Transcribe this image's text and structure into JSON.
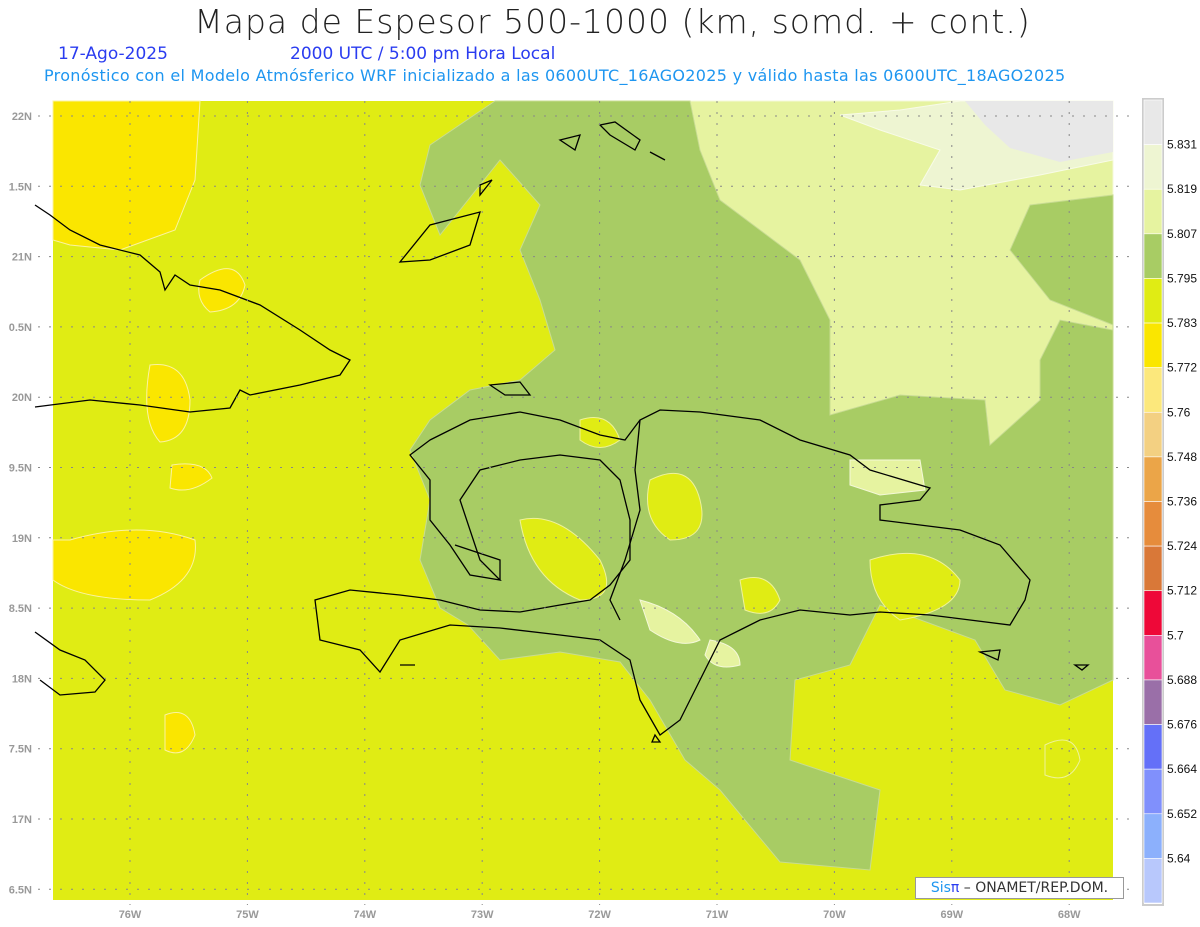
{
  "header": {
    "title": "Mapa de Espesor 500-1000 (km, somd. + cont.)",
    "date": "17-Ago-2025",
    "time": "2000 UTC / 5:00 pm Hora Local",
    "subtitle": "Pronóstico con el Modelo Atmósferico WRF inicializado a las 0600UTC_16AGO2025 y válido hasta las  0600UTC_18AGO2025"
  },
  "axes": {
    "lat_labels": [
      "22N",
      "1.5N",
      "21N",
      "0.5N",
      "20N",
      "9.5N",
      "19N",
      "8.5N",
      "18N",
      "7.5N",
      "17N",
      "6.5N"
    ],
    "lon_labels": [
      "76W",
      "75W",
      "74W",
      "73W",
      "72W",
      "71W",
      "70W",
      "69W",
      "68W"
    ]
  },
  "legend": {
    "labels": [
      "5.831",
      "5.819",
      "5.807",
      "5.795",
      "5.783",
      "5.772",
      "5.76",
      "5.748",
      "5.736",
      "5.724",
      "5.712",
      "5.7",
      "5.688",
      "5.676",
      "5.664",
      "5.652",
      "5.64"
    ],
    "colors": [
      "#e8e8e8",
      "#eef5d2",
      "#e6f3a0",
      "#a8cc64",
      "#e0ec14",
      "#fae600",
      "#fce87c",
      "#f3d082",
      "#eba548",
      "#e68c3c",
      "#d97838",
      "#ee0838",
      "#e8509a",
      "#9a6fa8",
      "#6470f8",
      "#8090fc",
      "#8cb0fc",
      "#b8c8fc"
    ]
  },
  "credit": {
    "brand_a": "Sis",
    "brand_b": "π",
    "text": " –  ONAMET/REP.DOM."
  }
}
